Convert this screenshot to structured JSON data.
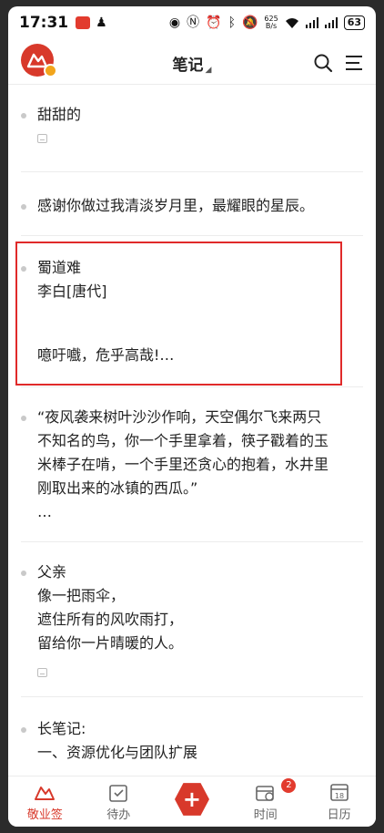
{
  "status_bar": {
    "time": "17:31",
    "speed_top": "625",
    "speed_bottom": "B/s",
    "battery": "63"
  },
  "header": {
    "title": "笔记"
  },
  "notes": [
    {
      "lines": [
        "甜甜的"
      ],
      "attachment": true
    },
    {
      "lines": [
        "感谢你做过我清淡岁月里，最耀眼的星辰。"
      ],
      "attachment": false
    },
    {
      "lines": [
        "蜀道难",
        "李白[唐代]",
        "",
        "",
        "噫吁嚱，危乎高哉!…"
      ],
      "attachment": false
    },
    {
      "lines": [
        "“夜风袭来树叶沙沙作响，天空偶尔飞来两只",
        "不知名的鸟，你一个手里拿着，筷子戳着的玉",
        "米棒子在啃，一个手里还贪心的抱着，水井里",
        "刚取出来的冰镇的西瓜。”",
        " …"
      ],
      "attachment": false
    },
    {
      "lines": [
        "父亲",
        "像一把雨伞，",
        "遮住所有的风吹雨打，",
        "留给你一片晴暖的人。"
      ],
      "attachment": true
    },
    {
      "lines": [
        "长笔记:",
        "一、资源优化与团队扩展"
      ],
      "attachment": false
    }
  ],
  "bottom_nav": {
    "jingyeqian": "敬业签",
    "daiban": "待办",
    "add": "+",
    "shijian": "时间",
    "shijian_badge": "2",
    "rili": "日历",
    "rili_day": "18"
  },
  "colors": {
    "brand": "#d8392b",
    "highlight_border": "#e02a2a"
  }
}
